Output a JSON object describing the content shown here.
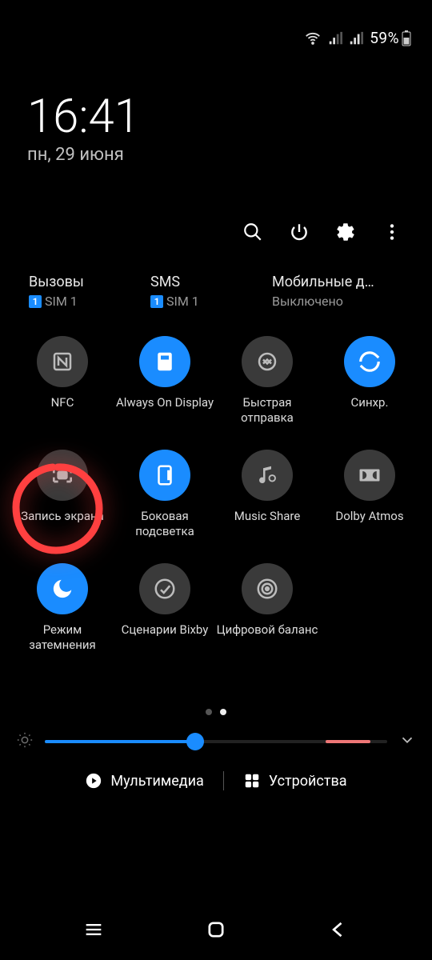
{
  "status": {
    "battery": "59%"
  },
  "clock": {
    "time": "16:41",
    "date": "пн, 29 июня"
  },
  "sim": [
    {
      "title": "Вызовы",
      "sub": "SIM 1",
      "badge": "1"
    },
    {
      "title": "SMS",
      "sub": "SIM 1",
      "badge": "1"
    },
    {
      "title": "Мобильные да…",
      "sub": "Выключено",
      "badge": ""
    }
  ],
  "tiles": [
    {
      "label": "NFC",
      "on": false,
      "icon": "nfc"
    },
    {
      "label": "Always On Display",
      "on": true,
      "icon": "aod"
    },
    {
      "label": "Быстрая отправка",
      "on": false,
      "icon": "quickshare"
    },
    {
      "label": "Синхр.",
      "on": true,
      "icon": "sync"
    },
    {
      "label": "Запись экрана",
      "on": false,
      "icon": "screenrec"
    },
    {
      "label": "Боковая подсветка",
      "on": true,
      "icon": "edge"
    },
    {
      "label": "Music Share",
      "on": false,
      "icon": "musicshare"
    },
    {
      "label": "Dolby Atmos",
      "on": false,
      "icon": "dolby"
    },
    {
      "label": "Режим затемнения",
      "on": true,
      "icon": "darkmode"
    },
    {
      "label": "Сценарии Bixby",
      "on": false,
      "icon": "bixby"
    },
    {
      "label": "Цифровой баланс",
      "on": false,
      "icon": "wellbeing"
    }
  ],
  "pager": {
    "total": 2,
    "active": 1
  },
  "brightness": {
    "value_pct": 44,
    "track2_start_pct": 82,
    "track2_end_pct": 95
  },
  "footer": {
    "media": "Мультимедиа",
    "devices": "Устройства"
  }
}
